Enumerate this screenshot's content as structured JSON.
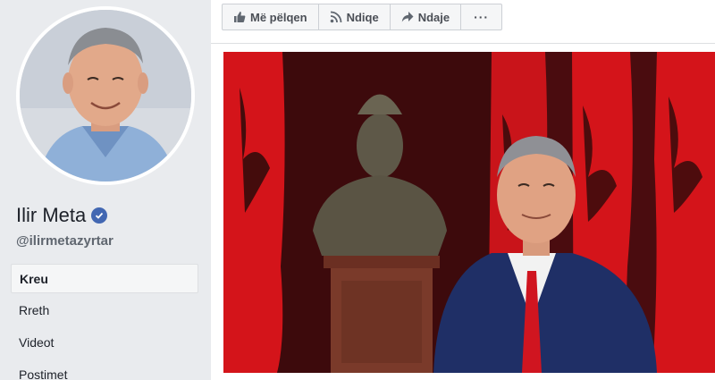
{
  "profile": {
    "name": "Ilir Meta",
    "handle": "@ilirmetazyrtar",
    "verified": true
  },
  "nav": {
    "items": [
      {
        "label": "Kreu",
        "active": true
      },
      {
        "label": "Rreth",
        "active": false
      },
      {
        "label": "Videot",
        "active": false
      },
      {
        "label": "Postimet",
        "active": false
      }
    ]
  },
  "toolbar": {
    "like_label": "Më pëlqen",
    "follow_label": "Ndiqe",
    "share_label": "Ndaje",
    "more_label": "···"
  },
  "icons": {
    "like": "thumbs-up-icon",
    "follow": "rss-icon",
    "share": "share-arrow-icon",
    "verified": "verified-check-icon"
  },
  "colors": {
    "page_bg": "#e9ebee",
    "accent": "#4267b2",
    "flag_red": "#d4141a",
    "curtain": "#5a0f12"
  }
}
